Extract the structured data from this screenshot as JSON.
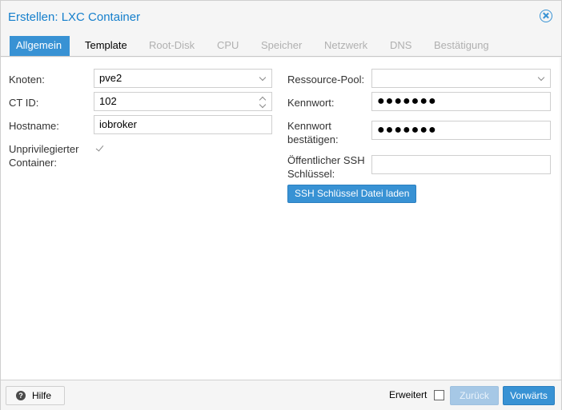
{
  "window": {
    "title": "Erstellen: LXC Container"
  },
  "tabs": [
    {
      "label": "Allgemein",
      "state": "active"
    },
    {
      "label": "Template",
      "state": "enabled"
    },
    {
      "label": "Root-Disk",
      "state": "disabled"
    },
    {
      "label": "CPU",
      "state": "disabled"
    },
    {
      "label": "Speicher",
      "state": "disabled"
    },
    {
      "label": "Netzwerk",
      "state": "disabled"
    },
    {
      "label": "DNS",
      "state": "disabled"
    },
    {
      "label": "Bestätigung",
      "state": "disabled"
    }
  ],
  "form_left": {
    "node_label": "Knoten:",
    "node_value": "pve2",
    "ctid_label": "CT ID:",
    "ctid_value": "102",
    "hostname_label": "Hostname:",
    "hostname_value": "iobroker",
    "unprivileged_label_line1": "Unprivilegierter",
    "unprivileged_label_line2": "Container:",
    "unprivileged_checked": true
  },
  "form_right": {
    "pool_label": "Ressource-Pool:",
    "pool_value": "",
    "password_label": "Kennwort:",
    "password_mask": "●●●●●●●",
    "confirm_label_line1": "Kennwort",
    "confirm_label_line2": "bestätigen:",
    "confirm_mask": "●●●●●●●",
    "ssh_label_line1": "Öffentlicher SSH",
    "ssh_label_line2": "Schlüssel:",
    "ssh_value": "",
    "ssh_load_button": "SSH Schlüssel Datei laden"
  },
  "footer": {
    "help_label": "Hilfe",
    "help_icon_glyph": "?",
    "advanced_label": "Erweitert",
    "advanced_checked": false,
    "back_label": "Zurück",
    "next_label": "Vorwärts"
  },
  "colors": {
    "accent": "#3892d4",
    "title": "#157fcc",
    "disabled_tab": "#b0b0b0",
    "back_disabled": "#a6c8e6"
  },
  "icons": {
    "close": "close-circle-icon",
    "help": "question-circle-icon",
    "dropdown": "chevron-down-icon",
    "spinner": "spinner-arrows-icon",
    "check": "checkmark-icon"
  }
}
